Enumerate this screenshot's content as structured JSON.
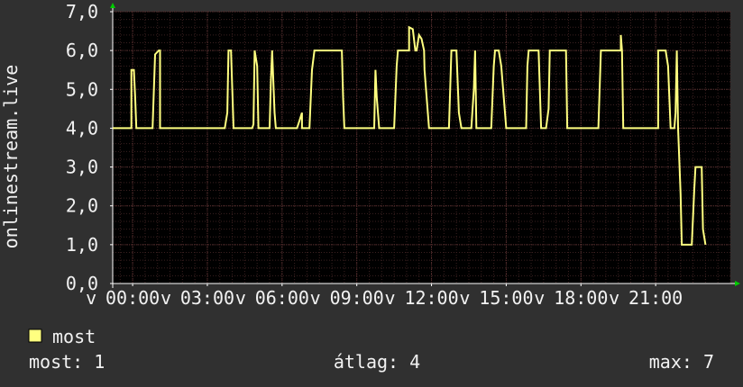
{
  "chart_data": {
    "type": "line",
    "ylabel": "onlinestream.live",
    "ylim": [
      0,
      7
    ],
    "y_ticks": [
      "0,0",
      "1,0",
      "2,0",
      "3,0",
      "4,0",
      "5,0",
      "6,0",
      "7,0"
    ],
    "x_ticks": [
      "00:00",
      "03:00",
      "06:00",
      "09:00",
      "12:00",
      "15:00",
      "18:00",
      "21:00"
    ],
    "x_tick_prefix": "v",
    "x_range_hours": [
      -0.8,
      24.0
    ],
    "grid": true,
    "colors": {
      "background": "#303030",
      "plot_background": "#000000",
      "grid_minor": "#3a2020",
      "grid_major": "#5a3030",
      "axis": "#ffffff",
      "arrow": "#00cc00",
      "series": "#ffff80"
    },
    "series": [
      {
        "name": "most",
        "color": "#ffff80",
        "points": [
          [
            -0.8,
            4.0
          ],
          [
            -0.05,
            4.0
          ],
          [
            -0.05,
            5.5
          ],
          [
            0.05,
            5.5
          ],
          [
            0.1,
            4.8
          ],
          [
            0.15,
            4.0
          ],
          [
            0.8,
            4.0
          ],
          [
            0.9,
            5.9
          ],
          [
            1.05,
            6.0
          ],
          [
            1.1,
            6.0
          ],
          [
            1.1,
            4.0
          ],
          [
            3.7,
            4.0
          ],
          [
            3.8,
            4.4
          ],
          [
            3.85,
            6.0
          ],
          [
            3.95,
            6.0
          ],
          [
            4.05,
            4.0
          ],
          [
            4.8,
            4.0
          ],
          [
            4.85,
            4.1
          ],
          [
            4.9,
            6.0
          ],
          [
            5.0,
            5.6
          ],
          [
            5.05,
            4.0
          ],
          [
            5.5,
            4.0
          ],
          [
            5.55,
            5.2
          ],
          [
            5.6,
            6.0
          ],
          [
            5.7,
            4.4
          ],
          [
            5.75,
            4.0
          ],
          [
            6.6,
            4.0
          ],
          [
            6.7,
            4.2
          ],
          [
            6.8,
            4.4
          ],
          [
            6.8,
            4.0
          ],
          [
            7.1,
            4.0
          ],
          [
            7.2,
            5.5
          ],
          [
            7.3,
            6.0
          ],
          [
            8.4,
            6.0
          ],
          [
            8.45,
            4.8
          ],
          [
            8.5,
            4.0
          ],
          [
            9.7,
            4.0
          ],
          [
            9.75,
            5.5
          ],
          [
            9.8,
            4.8
          ],
          [
            9.9,
            4.0
          ],
          [
            10.5,
            4.0
          ],
          [
            10.6,
            5.6
          ],
          [
            10.65,
            6.0
          ],
          [
            11.1,
            6.0
          ],
          [
            11.1,
            6.6
          ],
          [
            11.25,
            6.55
          ],
          [
            11.35,
            6.0
          ],
          [
            11.4,
            6.0
          ],
          [
            11.5,
            6.4
          ],
          [
            11.6,
            6.3
          ],
          [
            11.7,
            6.0
          ],
          [
            11.72,
            5.5
          ],
          [
            11.9,
            4.0
          ],
          [
            12.7,
            4.0
          ],
          [
            12.8,
            6.0
          ],
          [
            13.0,
            6.0
          ],
          [
            13.1,
            4.4
          ],
          [
            13.2,
            4.0
          ],
          [
            13.6,
            4.0
          ],
          [
            13.7,
            5.0
          ],
          [
            13.75,
            6.0
          ],
          [
            13.8,
            4.0
          ],
          [
            14.4,
            4.0
          ],
          [
            14.5,
            5.6
          ],
          [
            14.55,
            6.0
          ],
          [
            14.7,
            6.0
          ],
          [
            14.8,
            5.6
          ],
          [
            15.0,
            4.0
          ],
          [
            15.2,
            4.0
          ],
          [
            15.8,
            4.0
          ],
          [
            15.85,
            5.6
          ],
          [
            15.9,
            6.0
          ],
          [
            16.3,
            6.0
          ],
          [
            16.4,
            4.0
          ],
          [
            16.6,
            4.0
          ],
          [
            16.7,
            4.5
          ],
          [
            16.75,
            6.0
          ],
          [
            17.4,
            6.0
          ],
          [
            17.45,
            4.0
          ],
          [
            18.7,
            4.0
          ],
          [
            18.8,
            6.0
          ],
          [
            19.6,
            6.0
          ],
          [
            19.6,
            6.4
          ],
          [
            19.65,
            6.0
          ],
          [
            19.7,
            4.0
          ],
          [
            21.1,
            4.0
          ],
          [
            21.1,
            6.0
          ],
          [
            21.4,
            6.0
          ],
          [
            21.5,
            5.6
          ],
          [
            21.6,
            4.0
          ],
          [
            21.75,
            4.0
          ],
          [
            21.8,
            4.4
          ],
          [
            21.85,
            6.0
          ],
          [
            21.9,
            4.0
          ],
          [
            22.0,
            2.3
          ],
          [
            22.05,
            1.0
          ],
          [
            22.45,
            1.0
          ],
          [
            22.55,
            2.4
          ],
          [
            22.6,
            3.0
          ],
          [
            22.85,
            3.0
          ],
          [
            22.9,
            1.4
          ],
          [
            23.0,
            1.0
          ]
        ]
      }
    ]
  },
  "legend": {
    "series_label": "most"
  },
  "stats": {
    "current": "most: 1",
    "average": "átlag: 4",
    "max": "max: 7"
  }
}
